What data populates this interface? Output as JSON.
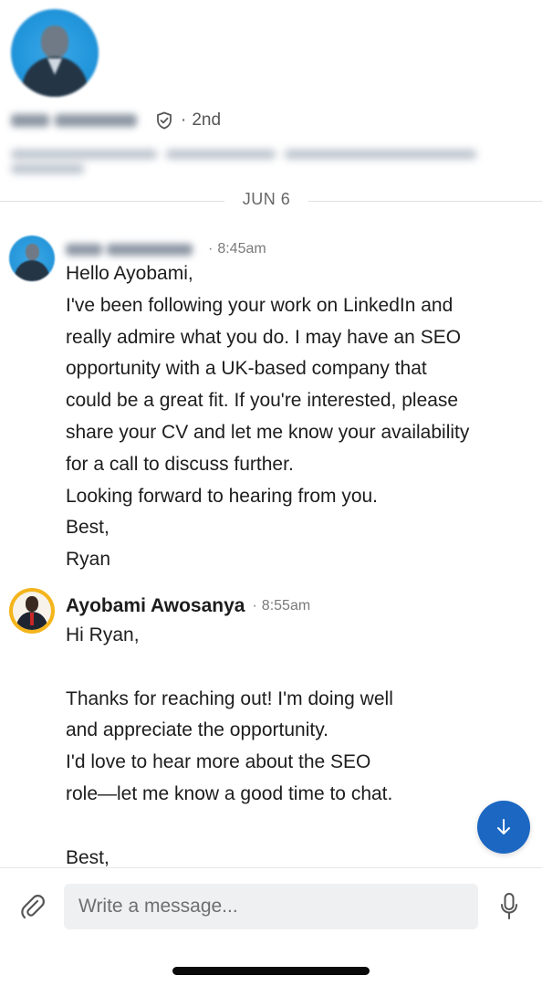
{
  "profile": {
    "name": "Ryan McKeown",
    "degree": "2nd",
    "degree_separator": "·",
    "headline": "Attorney | Co-Founder @ Best Era, LLC | Adjunct Faculty @ Sincere Colu"
  },
  "date_divider": "JUN 6",
  "messages": [
    {
      "sender": "Ryan McKeown",
      "separator": "·",
      "time": "8:45am",
      "lines": [
        "Hello Ayobami,",
        "I've been following your work on LinkedIn and",
        "really admire what you do. I may have an SEO",
        "opportunity with a UK-based company that",
        "could be a great fit. If you're interested, please",
        "share your CV and let me know your availability",
        "for a call to discuss further.",
        "Looking forward to hearing from you.",
        "Best,",
        "Ryan"
      ]
    },
    {
      "sender": "Ayobami Awosanya",
      "separator": "·",
      "time": "8:55am",
      "lines": [
        "Hi Ryan,",
        "",
        "Thanks for reaching out! I'm doing well",
        "and appreciate the opportunity.",
        "I'd love to hear more about the SEO",
        "role—let me know a good time to chat.",
        "",
        "Best,"
      ]
    }
  ],
  "composer": {
    "placeholder": "Write a message..."
  },
  "icons": {
    "verified": "shield-check-icon",
    "scroll_down": "arrow-down-icon",
    "attach": "paperclip-icon",
    "mic": "microphone-icon"
  },
  "colors": {
    "accent": "#1c67c2",
    "text": "#1d1d1d",
    "muted": "#7a7a7a",
    "input_bg": "#eef0f2"
  }
}
